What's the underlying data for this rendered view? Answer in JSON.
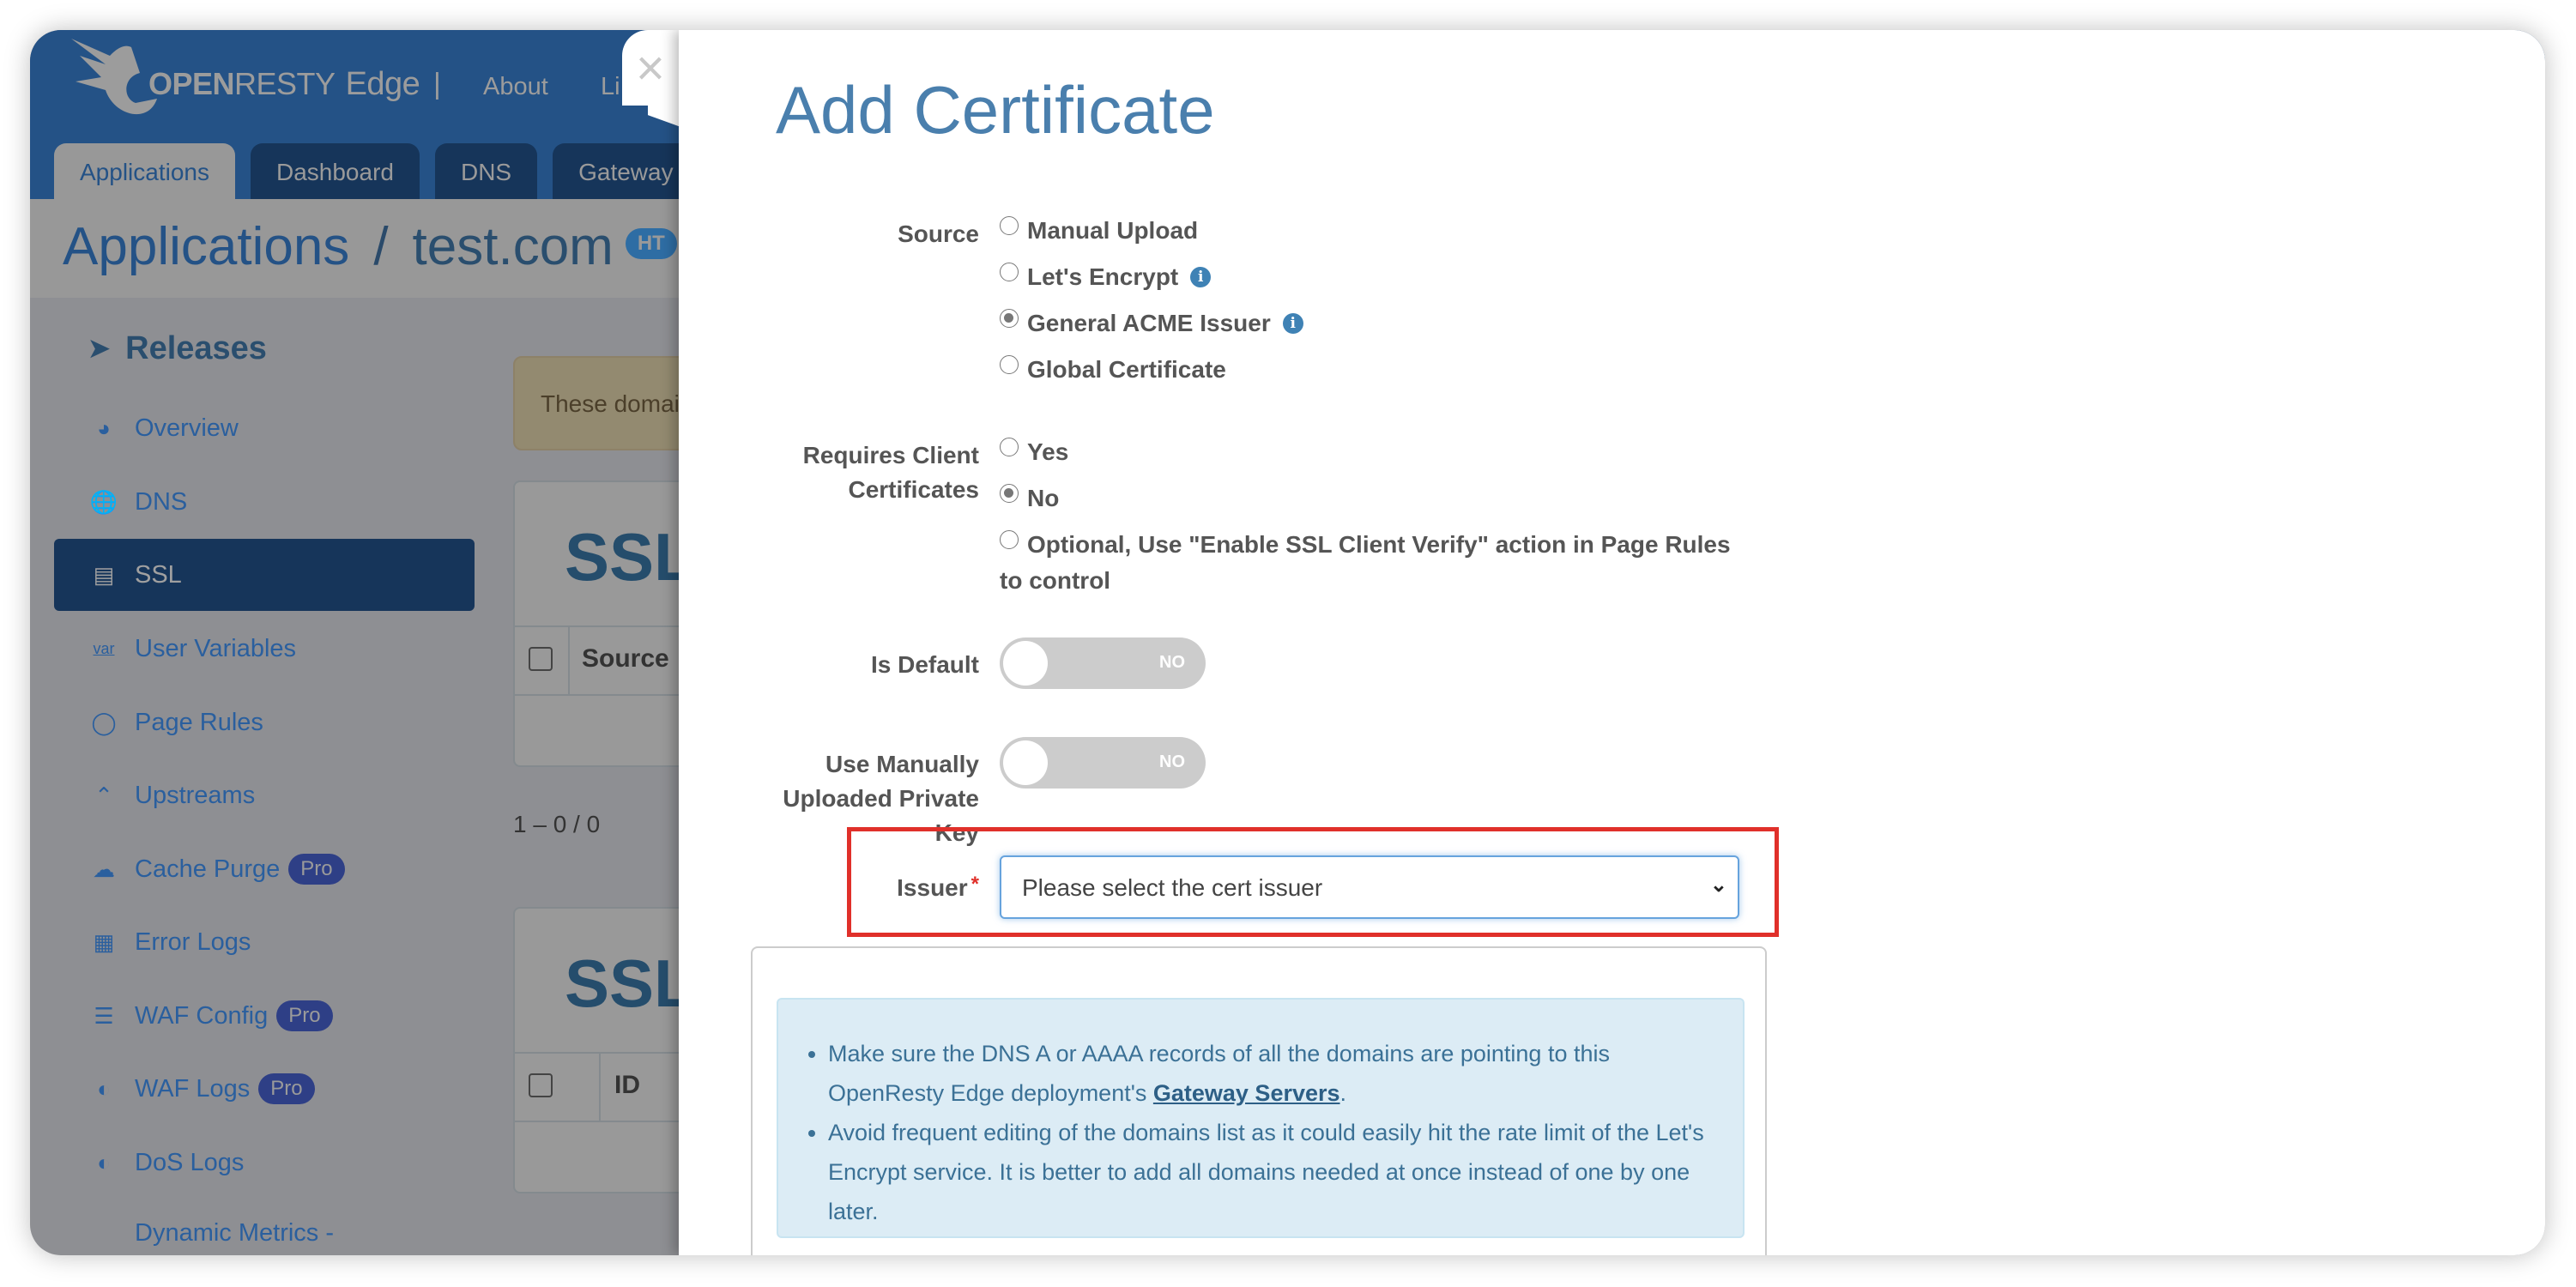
{
  "app": {
    "brand_open": "OPEN",
    "brand_resty": "RESTY",
    "brand_edge": "Edge",
    "brand_separator": "|",
    "nav_links": [
      "About",
      "Li"
    ],
    "tabs": [
      "Applications",
      "Dashboard",
      "DNS",
      "Gateway"
    ],
    "active_tab": "Applications",
    "breadcrumb": {
      "parent": "Applications",
      "separator": "/",
      "current": "test.com",
      "badge": "HT"
    }
  },
  "sidebar": {
    "header": "Releases",
    "items": [
      {
        "label": "Overview",
        "icon": "gauge-icon"
      },
      {
        "label": "DNS",
        "icon": "dns-globe-icon"
      },
      {
        "label": "SSL",
        "icon": "ssl-lock-icon",
        "active": true
      },
      {
        "label": "User Variables",
        "icon": "var-icon"
      },
      {
        "label": "Page Rules",
        "icon": "page-rules-icon"
      },
      {
        "label": "Upstreams",
        "icon": "upstreams-icon"
      },
      {
        "label": "Cache Purge",
        "icon": "cloud-icon",
        "badge": "Pro"
      },
      {
        "label": "Error Logs",
        "icon": "error-log-icon"
      },
      {
        "label": "WAF Config",
        "icon": "list-icon",
        "badge": "Pro"
      },
      {
        "label": "WAF Logs",
        "icon": "waf-shield-icon",
        "badge": "Pro"
      },
      {
        "label": "DoS Logs",
        "icon": "dos-shield-icon"
      },
      {
        "label": "Dynamic Metrics -",
        "icon": "metrics-icon"
      }
    ]
  },
  "background": {
    "warning_text": "These domai",
    "panel1": {
      "title": "SSL",
      "columns": [
        "Source"
      ]
    },
    "pager": "1 – 0 / 0",
    "panel2": {
      "title": "SSL",
      "columns": [
        "ID"
      ]
    }
  },
  "modal": {
    "title": "Add Certificate",
    "close_label": "×",
    "source": {
      "label": "Source",
      "options": [
        {
          "label": "Manual Upload",
          "selected": false,
          "info": false
        },
        {
          "label": "Let's Encrypt",
          "selected": false,
          "info": true
        },
        {
          "label": "General ACME Issuer",
          "selected": true,
          "info": true
        },
        {
          "label": "Global Certificate",
          "selected": false,
          "info": false
        }
      ]
    },
    "client_certs": {
      "label_line1": "Requires Client",
      "label_line2": "Certificates",
      "options": [
        {
          "label": "Yes",
          "selected": false
        },
        {
          "label": "No",
          "selected": true
        },
        {
          "label": "Optional, Use \"Enable SSL Client Verify\" action in Page Rules",
          "label_cont": "to control",
          "selected": false
        }
      ]
    },
    "is_default": {
      "label": "Is Default",
      "value": "NO"
    },
    "manual_key": {
      "label_line1": "Use Manually",
      "label_line2": "Uploaded Private",
      "label_line3": "Key",
      "value": "NO"
    },
    "issuer": {
      "label": "Issuer",
      "required_mark": "*",
      "placeholder": "Please select the cert issuer"
    },
    "notes": {
      "item1_pre": "Make sure the DNS A or AAAA records of all the domains are pointing to this OpenResty Edge deployment's ",
      "item1_link": "Gateway Servers",
      "item1_post": ".",
      "item2": "Avoid frequent editing of the domains list as it could easily hit the rate limit of the Let's Encrypt service. It is better to add all domains needed at once instead of one by one later."
    }
  },
  "colors": {
    "accent": "#4a7fad",
    "highlight": "#e0302a",
    "header": "#245286",
    "info_bg": "#dcecf5"
  }
}
